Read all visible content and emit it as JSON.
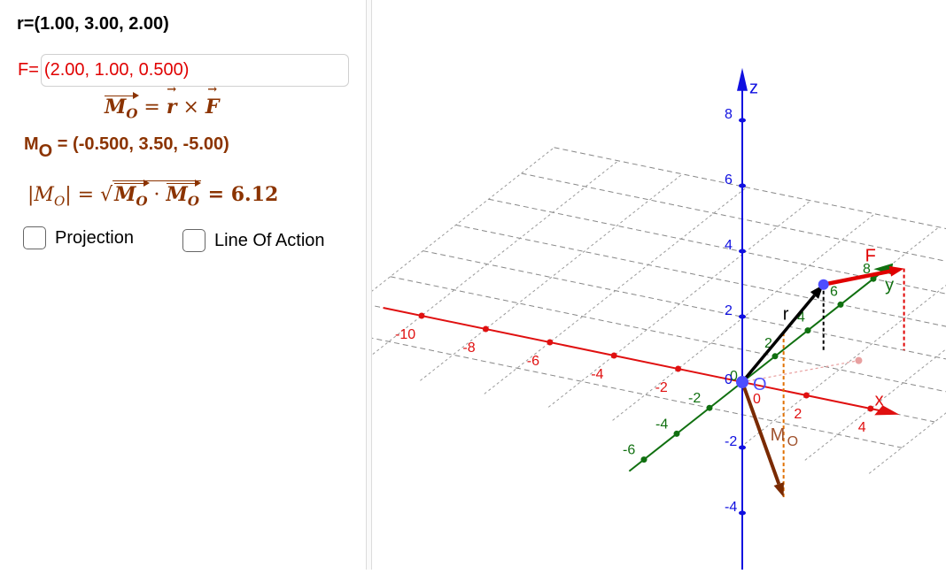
{
  "algebra": {
    "r_text": "r=(1.00, 3.00, 2.00)",
    "f_label": "F=",
    "f_value": "(2.00, 1.00, 0.500)",
    "formula1": {
      "lhs": "M",
      "lhs_sub": "O",
      "eq": " = ",
      "r": "r",
      "times": " × ",
      "f": "F"
    },
    "mo_label": "M",
    "mo_sub": "O",
    "mo_value": " = (-0.500, 3.50, -5.00)",
    "formula2": {
      "abs_open": "|M",
      "abs_sub": "O",
      "abs_close": "| = √",
      "a": "M",
      "a_sub": "O",
      "dot": " · ",
      "b": "M",
      "b_sub": "O",
      "result": " = 6.12"
    },
    "checkboxes": [
      {
        "label": "Projection",
        "checked": false
      },
      {
        "label": "Line Of Action",
        "checked": false
      }
    ]
  },
  "graphics": {
    "axes": {
      "x": {
        "label": "x",
        "color": "#e01010",
        "ticks": [
          -10,
          -8,
          -6,
          -4,
          -2,
          0,
          2,
          4
        ]
      },
      "y": {
        "label": "y",
        "color": "#107010",
        "ticks": [
          -6,
          -4,
          -2,
          0,
          2,
          4,
          6,
          8
        ]
      },
      "z": {
        "label": "z",
        "color": "#1010e0",
        "ticks": [
          -4,
          -2,
          0,
          2,
          4,
          6,
          8
        ]
      }
    },
    "origin_label": "O",
    "vectors": {
      "r": {
        "label": "r",
        "from": [
          0,
          0,
          0
        ],
        "to": [
          1,
          3,
          2
        ],
        "color": "#000000"
      },
      "F": {
        "label": "F",
        "from": [
          1,
          3,
          2
        ],
        "to": [
          3,
          4,
          2.5
        ],
        "color": "#e00000"
      },
      "Mo": {
        "label": "M",
        "label_sub": "O",
        "from": [
          0,
          0,
          0
        ],
        "to": [
          -0.5,
          3.5,
          -5
        ],
        "color": "#7a2a00"
      }
    },
    "colors": {
      "point": "#4d4dff",
      "projection_pink": "#e8a0a0",
      "mo_drop": "#e07000"
    }
  }
}
